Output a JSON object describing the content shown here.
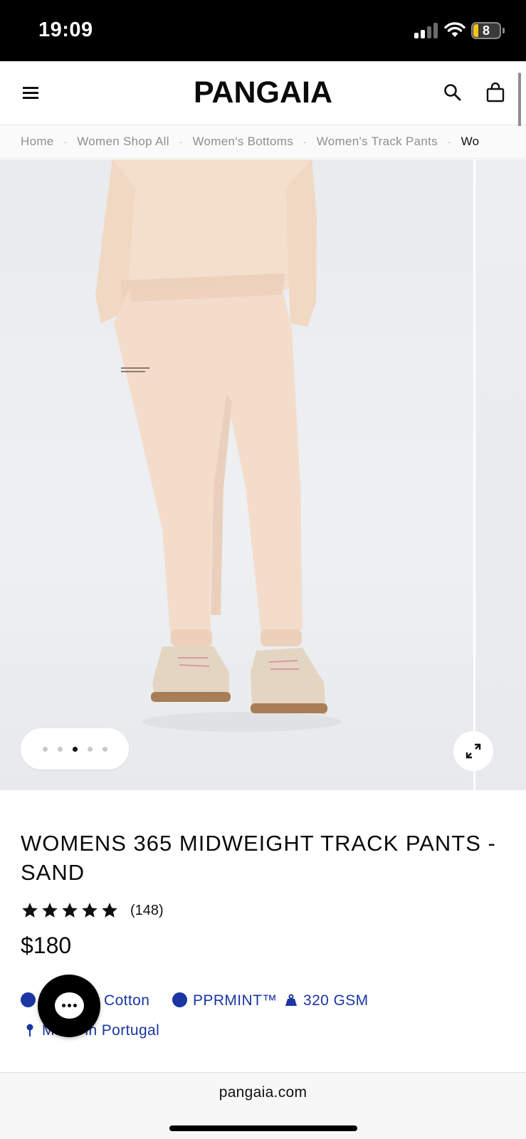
{
  "status_bar": {
    "time": "19:09",
    "battery_level": "8"
  },
  "header": {
    "logo_text": "PANGAIA",
    "menu_icon": "hamburger-menu-icon",
    "search_icon": "search-icon",
    "bag_icon": "shopping-bag-icon"
  },
  "breadcrumb": {
    "items": [
      {
        "label": "Home"
      },
      {
        "label": "Women Shop All"
      },
      {
        "label": "Women's Bottoms"
      },
      {
        "label": "Women's Track Pants"
      },
      {
        "label": "Wo"
      }
    ],
    "separator": "·"
  },
  "gallery": {
    "image_count": 5,
    "active_index": 3,
    "expand_icon": "expand-icon"
  },
  "product": {
    "title": "WOMENS 365 MIDWEIGHT TRACK PANTS - SAND",
    "rating": 5,
    "review_count": "(148)",
    "price": "$180",
    "features": {
      "cotton": "Cotton",
      "pprmint": "PPRMINT™",
      "weight": "320 GSM",
      "origin_hidden": "Ma",
      "origin": "de in Portugal"
    }
  },
  "chat": {
    "icon": "chat-bubble-icon"
  },
  "browser": {
    "url": "pangaia.com"
  },
  "colors": {
    "feature_blue": "#1b35a3",
    "status_bar_bg": "#000000",
    "battery_yellow": "#f5c518"
  }
}
